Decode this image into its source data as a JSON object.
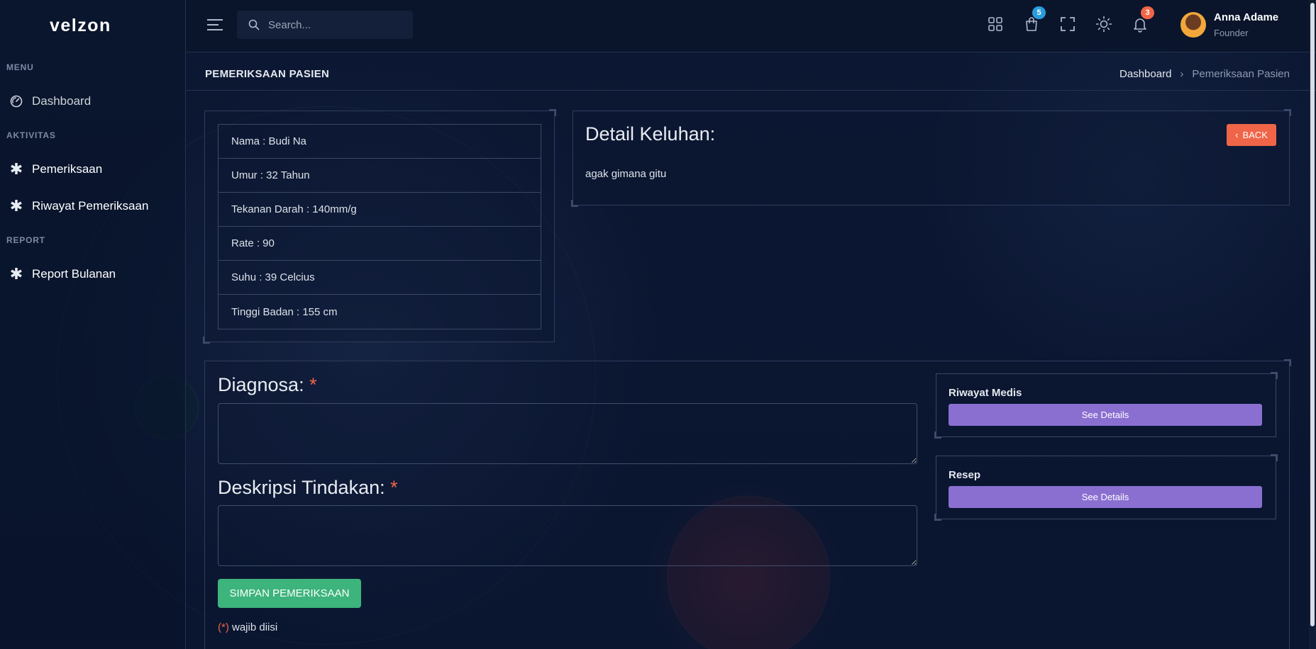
{
  "brand": {
    "logo_text": "velzon"
  },
  "sidebar": {
    "sections": [
      {
        "title": "MENU",
        "items": [
          {
            "label": "Dashboard",
            "icon": "dashboard-gauge-icon"
          }
        ]
      },
      {
        "title": "AKTIVITAS",
        "items": [
          {
            "label": "Pemeriksaan",
            "icon": "asterisk-icon"
          },
          {
            "label": "Riwayat Pemeriksaan",
            "icon": "asterisk-icon"
          }
        ]
      },
      {
        "title": "REPORT",
        "items": [
          {
            "label": "Report Bulanan",
            "icon": "asterisk-icon"
          }
        ]
      }
    ]
  },
  "topbar": {
    "search_placeholder": "Search...",
    "cart_badge": "5",
    "notification_badge": "3",
    "user": {
      "name": "Anna Adame",
      "role": "Founder"
    },
    "colors": {
      "badge_info": "#299cdb",
      "badge_danger": "#f06548"
    }
  },
  "page": {
    "title": "PEMERIKSAAN PASIEN",
    "breadcrumb": {
      "home": "Dashboard",
      "separator": "›",
      "current": "Pemeriksaan Pasien"
    }
  },
  "patient": {
    "rows": [
      "Nama : Budi Na",
      "Umur : 32 Tahun",
      "Tekanan Darah : 140mm/g",
      "Rate : 90",
      "Suhu : 39 Celcius",
      "Tinggi Badan : 155 cm"
    ]
  },
  "complaint": {
    "heading": "Detail Keluhan:",
    "text": "agak gimana gitu",
    "back_label": "BACK"
  },
  "form": {
    "diagnosa_label": "Diagnosa:",
    "tindakan_label": "Deskripsi Tindakan:",
    "required_mark": "*",
    "diagnosa_value": "",
    "tindakan_value": "",
    "save_label": "SIMPAN PEMERIKSAAN",
    "note_mark": "(*)",
    "note_text": " wajib diisi"
  },
  "side_cards": [
    {
      "title": "Riwayat Medis",
      "button": "See Details"
    },
    {
      "title": "Resep",
      "button": "See Details"
    }
  ],
  "colors": {
    "accent_success": "#3cb47c",
    "accent_danger": "#f06548",
    "accent_purple": "#8a6fd1"
  }
}
